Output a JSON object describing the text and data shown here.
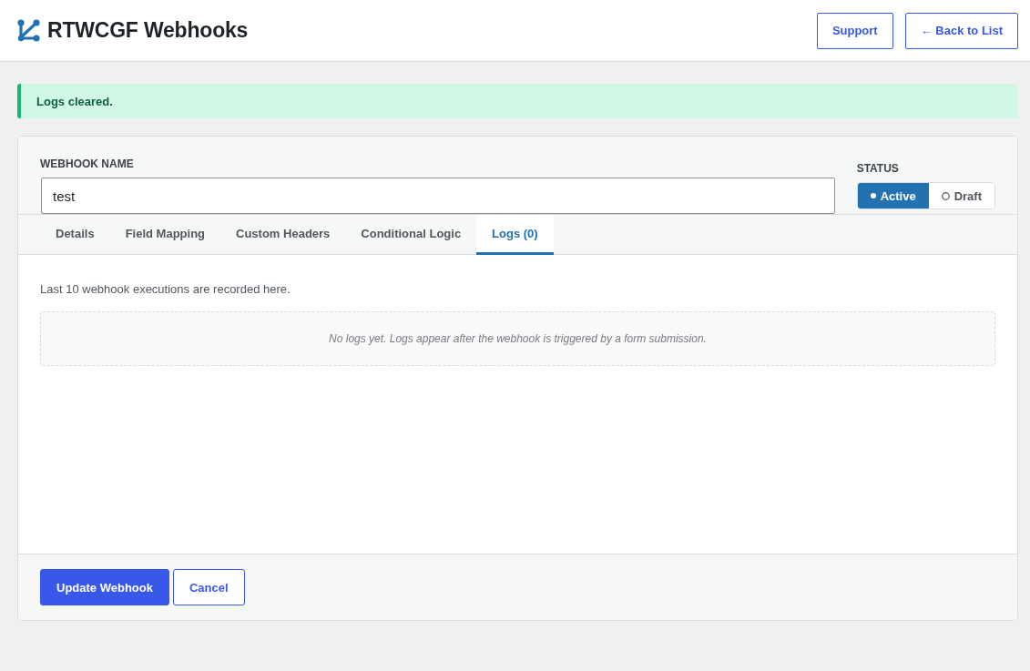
{
  "header": {
    "title": "RTWCGF Webhooks",
    "buttons": [
      "Support",
      "← Back to List"
    ]
  },
  "notice": {
    "kind": "success",
    "text": "Logs cleared."
  },
  "form": {
    "name_label": "WEBHOOK NAME",
    "name_value": "test",
    "status_label": "STATUS",
    "status_options": [
      {
        "label": "Active",
        "selected": true
      },
      {
        "label": "Draft",
        "selected": false
      }
    ]
  },
  "tabs": [
    {
      "label": "Details",
      "selected": false
    },
    {
      "label": "Field Mapping",
      "selected": false
    },
    {
      "label": "Custom Headers",
      "selected": false
    },
    {
      "label": "Conditional Logic",
      "selected": false
    },
    {
      "label": "Logs (0)",
      "selected": true
    }
  ],
  "logs": {
    "description": "Last 10 webhook executions are recorded here.",
    "empty_message": "No logs yet. Logs appear after the webhook is triggered by a form submission."
  },
  "footer": {
    "buttons": [
      {
        "label": "Update Webhook",
        "kind": "primary"
      },
      {
        "label": "Cancel",
        "kind": "secondary"
      }
    ]
  }
}
